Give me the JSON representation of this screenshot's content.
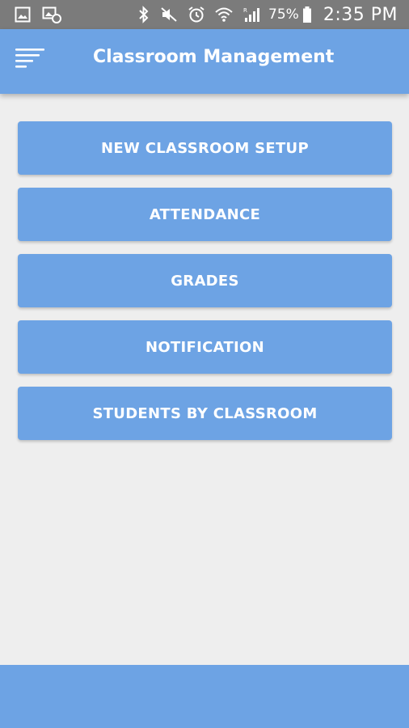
{
  "status_bar": {
    "left_icons": [
      "gallery-icon",
      "screenshot-icon"
    ],
    "right_icons": [
      "bluetooth-icon",
      "mute-icon",
      "alarm-icon",
      "wifi-icon",
      "signal-icon",
      "battery-icon"
    ],
    "battery_percent": "75%",
    "time": "2:35 PM"
  },
  "app_bar": {
    "menu_icon": "sort-menu-icon",
    "title": "Classroom Management"
  },
  "menu": {
    "items": [
      {
        "label": "NEW CLASSROOM SETUP"
      },
      {
        "label": "ATTENDANCE"
      },
      {
        "label": "GRADES"
      },
      {
        "label": "NOTIFICATION"
      },
      {
        "label": "STUDENTS BY CLASSROOM"
      }
    ]
  },
  "colors": {
    "primary": "#6da3e4",
    "background": "#eeeeee",
    "status_bar": "#7b7b7b",
    "text_on_primary": "#ffffff"
  }
}
